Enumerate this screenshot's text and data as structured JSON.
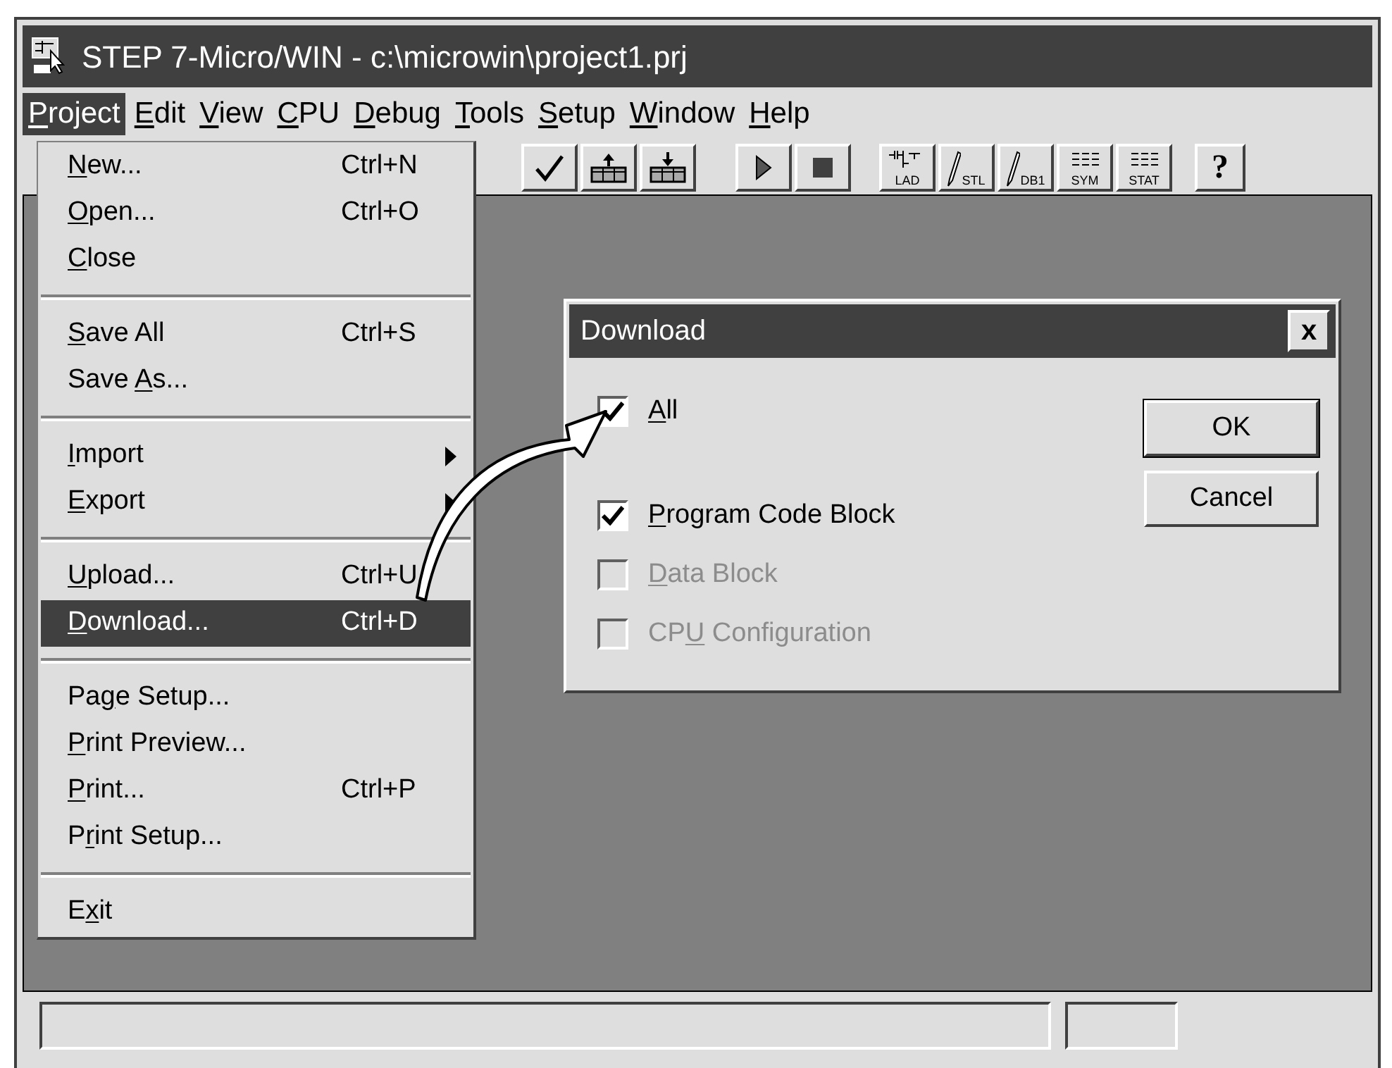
{
  "window": {
    "title": "STEP 7-Micro/WIN - c:\\microwin\\project1.prj"
  },
  "menubar": [
    {
      "label": {
        "key": "P",
        "post": "roject"
      },
      "selected": true
    },
    {
      "label": {
        "key": "E",
        "post": "dit"
      },
      "selected": false
    },
    {
      "label": {
        "key": "V",
        "post": "iew"
      },
      "selected": false
    },
    {
      "label": {
        "key": "C",
        "post": "PU"
      },
      "selected": false
    },
    {
      "label": {
        "key": "D",
        "post": "ebug"
      },
      "selected": false
    },
    {
      "label": {
        "key": "T",
        "post": "ools"
      },
      "selected": false
    },
    {
      "label": {
        "key": "S",
        "post": "etup"
      },
      "selected": false
    },
    {
      "label": {
        "key": "W",
        "post": "indow"
      },
      "selected": false
    },
    {
      "label": {
        "key": "H",
        "post": "elp"
      },
      "selected": false
    }
  ],
  "toolbar": [
    [
      {
        "kind": "check"
      },
      {
        "kind": "upload"
      },
      {
        "kind": "download"
      }
    ],
    [
      {
        "kind": "run"
      },
      {
        "kind": "stop"
      }
    ],
    [
      {
        "kind": "lad",
        "label": "LAD"
      },
      {
        "kind": "pen",
        "label": "STL"
      },
      {
        "kind": "pen",
        "label": "DB1"
      },
      {
        "kind": "table",
        "label": "SYM"
      },
      {
        "kind": "table",
        "label": "STAT"
      }
    ],
    [
      {
        "kind": "help",
        "label": "?"
      }
    ]
  ],
  "menu": [
    {
      "kind": "item",
      "label": {
        "key": "N",
        "post": "ew..."
      },
      "shortcut": "Ctrl+N",
      "selected": false
    },
    {
      "kind": "item",
      "label": {
        "key": "O",
        "post": "pen..."
      },
      "shortcut": "Ctrl+O",
      "selected": false
    },
    {
      "kind": "item",
      "label": {
        "key": "C",
        "post": "lose"
      },
      "selected": false
    },
    {
      "kind": "separator"
    },
    {
      "kind": "item",
      "label": {
        "key": "S",
        "post": "ave All"
      },
      "shortcut": "Ctrl+S",
      "selected": false
    },
    {
      "kind": "item",
      "label": {
        "pre": "Save ",
        "key": "A",
        "post": "s..."
      },
      "selected": false
    },
    {
      "kind": "separator"
    },
    {
      "kind": "submenu",
      "label": {
        "key": "I",
        "post": "mport"
      },
      "selected": false
    },
    {
      "kind": "submenu",
      "label": {
        "key": "E",
        "post": "xport"
      },
      "selected": false
    },
    {
      "kind": "separator"
    },
    {
      "kind": "item",
      "label": {
        "key": "U",
        "post": "pload..."
      },
      "shortcut": "Ctrl+U",
      "selected": false
    },
    {
      "kind": "item",
      "label": {
        "key": "D",
        "post": "ownload..."
      },
      "shortcut": "Ctrl+D",
      "selected": true
    },
    {
      "kind": "separator"
    },
    {
      "kind": "item",
      "label": {
        "pre": "Pa",
        "key": "g",
        "post": "e Setup..."
      },
      "selected": false
    },
    {
      "kind": "item",
      "label": {
        "key": "P",
        "post": "rint Preview..."
      },
      "selected": false
    },
    {
      "kind": "item",
      "label": {
        "key": "P",
        "post": "rint..."
      },
      "shortcut": "Ctrl+P",
      "selected": false
    },
    {
      "kind": "item",
      "label": {
        "pre": "P",
        "key": "r",
        "post": "int Setup..."
      },
      "selected": false
    },
    {
      "kind": "separator"
    },
    {
      "kind": "item",
      "label": {
        "pre": "E",
        "key": "x",
        "post": "it"
      },
      "selected": false
    }
  ],
  "dialog": {
    "title": "Download",
    "close_label": "x",
    "options": [
      {
        "label": {
          "key": "A",
          "post": "ll"
        },
        "checked": true,
        "disabled": false
      },
      {
        "label": {
          "key": "P",
          "post": "rogram Code Block"
        },
        "checked": true,
        "disabled": false
      },
      {
        "label": {
          "key": "D",
          "post": "ata Block"
        },
        "checked": false,
        "disabled": true
      },
      {
        "label": {
          "pre": "CP",
          "key": "U",
          "post": " Configuration"
        },
        "checked": false,
        "disabled": true
      }
    ],
    "buttons": [
      "OK",
      "Cancel"
    ]
  }
}
